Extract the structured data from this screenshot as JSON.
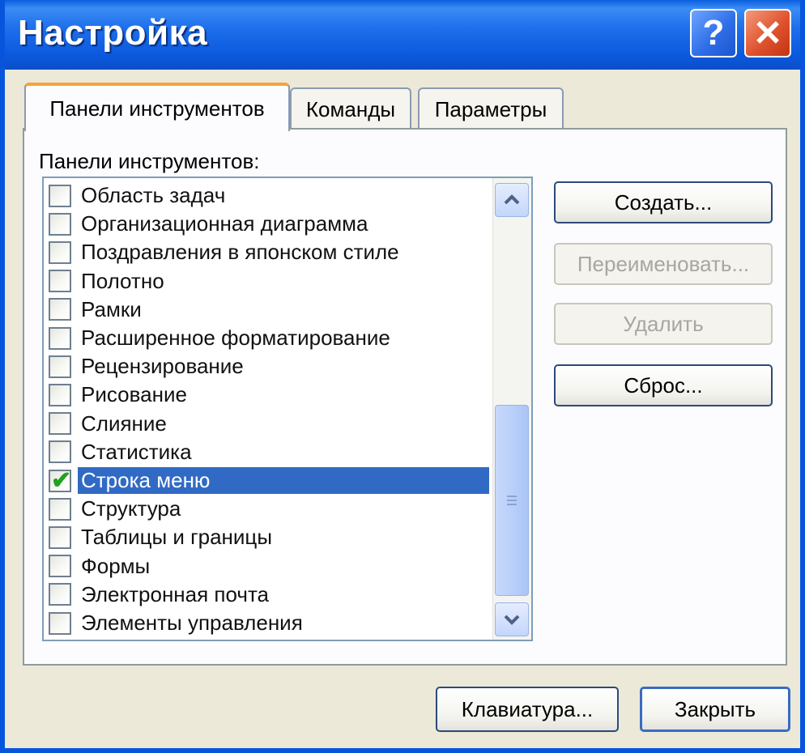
{
  "window": {
    "title": "Настройка"
  },
  "titlebar_buttons": {
    "help": "?",
    "close": "✕"
  },
  "tabs": [
    {
      "label": "Панели инструментов",
      "active": true
    },
    {
      "label": "Команды",
      "active": false
    },
    {
      "label": "Параметры",
      "active": false
    }
  ],
  "toolbars_list": {
    "caption": "Панели инструментов:",
    "items": [
      {
        "label": "Область задач",
        "checked": false
      },
      {
        "label": "Организационная диаграмма",
        "checked": false
      },
      {
        "label": "Поздравления в японском стиле",
        "checked": false
      },
      {
        "label": "Полотно",
        "checked": false
      },
      {
        "label": "Рамки",
        "checked": false
      },
      {
        "label": "Расширенное форматирование",
        "checked": false
      },
      {
        "label": "Рецензирование",
        "checked": false
      },
      {
        "label": "Рисование",
        "checked": false
      },
      {
        "label": "Слияние",
        "checked": false
      },
      {
        "label": "Статистика",
        "checked": false
      },
      {
        "label": "Строка меню",
        "checked": true,
        "selected": true
      },
      {
        "label": "Структура",
        "checked": false
      },
      {
        "label": "Таблицы и границы",
        "checked": false
      },
      {
        "label": "Формы",
        "checked": false
      },
      {
        "label": "Электронная почта",
        "checked": false
      },
      {
        "label": "Элементы управления",
        "checked": false
      }
    ]
  },
  "scrollbar": {
    "up_icon": "chevron-up-icon",
    "down_icon": "chevron-down-icon"
  },
  "side_buttons": {
    "create": "Создать...",
    "rename": "Переименовать...",
    "delete": "Удалить",
    "reset": "Сброс..."
  },
  "footer_buttons": {
    "keyboard": "Клавиатура...",
    "close": "Закрыть"
  },
  "colors": {
    "titlebar": "#0b58dd",
    "selection": "#316ac5",
    "tab_active_accent": "#f5a33a",
    "close_button": "#e0522e",
    "checkmark": "#21a121"
  }
}
